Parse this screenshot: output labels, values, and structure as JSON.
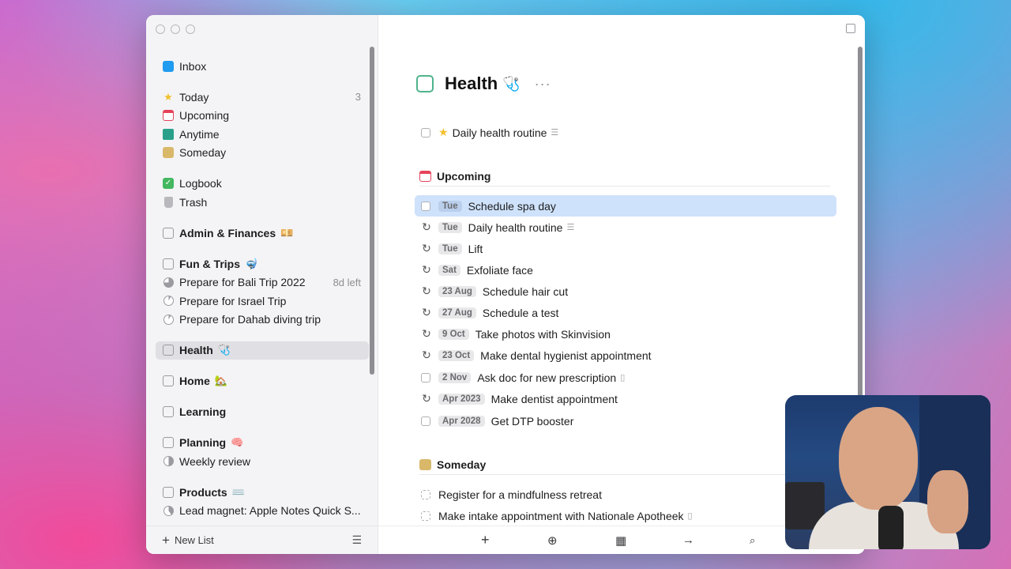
{
  "sidebar": {
    "items": [
      {
        "label": "Inbox",
        "icon": "inbox-icon"
      },
      {
        "label": "Today",
        "icon": "star-icon",
        "count": "3"
      },
      {
        "label": "Upcoming",
        "icon": "calendar-icon"
      },
      {
        "label": "Anytime",
        "icon": "layers-icon"
      },
      {
        "label": "Someday",
        "icon": "archive-box-icon"
      },
      {
        "label": "Logbook",
        "icon": "logbook-check-icon"
      },
      {
        "label": "Trash",
        "icon": "trash-icon"
      }
    ],
    "areas": [
      {
        "label": "Admin & Finances",
        "emoji": "💴"
      },
      {
        "label": "Fun & Trips",
        "emoji": "🤿"
      },
      {
        "label": "Health",
        "emoji": "🩺"
      },
      {
        "label": "Home",
        "emoji": "🏡"
      },
      {
        "label": "Learning",
        "emoji": ""
      },
      {
        "label": "Planning",
        "emoji": "🧠"
      },
      {
        "label": "Products",
        "emoji": "⌨️"
      }
    ],
    "projects": {
      "fun": [
        {
          "label": "Prepare for Bali Trip 2022",
          "meta": "8d left"
        },
        {
          "label": "Prepare for Israel Trip"
        },
        {
          "label": "Prepare for Dahab diving trip"
        }
      ],
      "planning": [
        {
          "label": "Weekly review"
        }
      ],
      "products": [
        {
          "label": "Lead magnet: Apple Notes Quick S..."
        }
      ]
    },
    "footer": {
      "new_list": "New List"
    }
  },
  "main": {
    "title": "Health",
    "title_emoji": "🩺",
    "more": "···",
    "top_task": "Daily health routine",
    "sections": {
      "upcoming": "Upcoming",
      "someday": "Someday"
    },
    "upcoming_tasks": [
      {
        "date": "Tue",
        "title": "Schedule spa day",
        "repeat": false,
        "note": false
      },
      {
        "date": "Tue",
        "title": "Daily health routine",
        "repeat": true,
        "note": true
      },
      {
        "date": "Tue",
        "title": "Lift",
        "repeat": true,
        "note": false
      },
      {
        "date": "Sat",
        "title": "Exfoliate face",
        "repeat": true,
        "note": false
      },
      {
        "date": "23 Aug",
        "title": "Schedule hair cut",
        "repeat": true,
        "note": false
      },
      {
        "date": "27 Aug",
        "title": "Schedule a test",
        "repeat": true,
        "note": false
      },
      {
        "date": "9 Oct",
        "title": "Take photos with Skinvision",
        "repeat": true,
        "note": false
      },
      {
        "date": "23 Oct",
        "title": "Make dental hygienist appointment",
        "repeat": true,
        "note": false
      },
      {
        "date": "2 Nov",
        "title": "Ask doc for new prescription",
        "repeat": false,
        "note": true
      },
      {
        "date": "Apr 2023",
        "title": "Make dentist appointment",
        "repeat": true,
        "note": false
      },
      {
        "date": "Apr 2028",
        "title": "Get DTP booster",
        "repeat": false,
        "note": false
      }
    ],
    "someday_tasks": [
      {
        "title": "Register for a mindfulness retreat"
      },
      {
        "title": "Make intake appointment with Nationale Apotheek"
      }
    ],
    "footer_icons": [
      "plus-icon",
      "add-circle-icon",
      "calendar-icon",
      "arrow-right-icon",
      "search-icon"
    ]
  },
  "colors": {
    "accent_selection": "#cfe2fb",
    "health_area": "#4fb38d",
    "today_star": "#f2c12e",
    "upcoming_red": "#e5435a",
    "someday_tan": "#d9b86a"
  }
}
